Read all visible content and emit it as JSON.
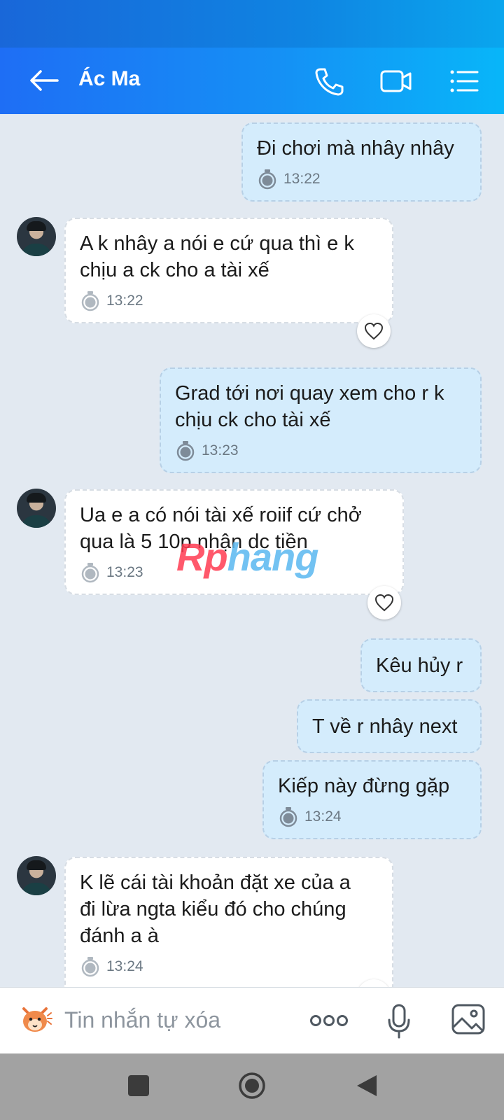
{
  "header": {
    "title": "Ác Ma",
    "icons": [
      "back-arrow-icon",
      "phone-icon",
      "video-call-icon",
      "menu-list-icon"
    ]
  },
  "messages": [
    {
      "dir": "out",
      "lines": [
        "Đi chơi mà nhây nhây"
      ],
      "time": "13:22"
    },
    {
      "dir": "in",
      "lines": [
        "A k nhây a nói e cứ qua thì e k",
        "chịu a ck cho a tài xế"
      ],
      "time": "13:22"
    },
    {
      "dir": "out",
      "lines": [
        "Grad tới nơi quay xem cho r k",
        "chịu ck cho tài xế"
      ],
      "time": "13:23"
    },
    {
      "dir": "in",
      "lines": [
        "Ua e a có nói tài xế roiif cứ chở",
        "qua là 5 10p nhận dc tiền"
      ],
      "time": "13:23"
    },
    {
      "dir": "out",
      "lines": [
        "Kêu hủy r"
      ]
    },
    {
      "dir": "out",
      "lines": [
        "T về r nhây next"
      ]
    },
    {
      "dir": "out",
      "lines": [
        "Kiếp này đừng gặp"
      ],
      "time": "13:24"
    },
    {
      "dir": "in",
      "lines": [
        "K lẽ cái tài khoản đặt xe của a",
        "đi lừa ngta kiểu đó cho chúng",
        "đánh a à"
      ],
      "time": "13:24"
    }
  ],
  "watermark": {
    "part1": "Rp",
    "part2": "hang"
  },
  "input": {
    "placeholder": "Tin nhắn tự xóa"
  },
  "colors": {
    "header_start": "#1e6ef5",
    "header_end": "#08b6f9",
    "outgoing_bubble": "#d4ecfc",
    "incoming_bubble": "#ffffff",
    "chat_bg": "#e2e9f1"
  }
}
